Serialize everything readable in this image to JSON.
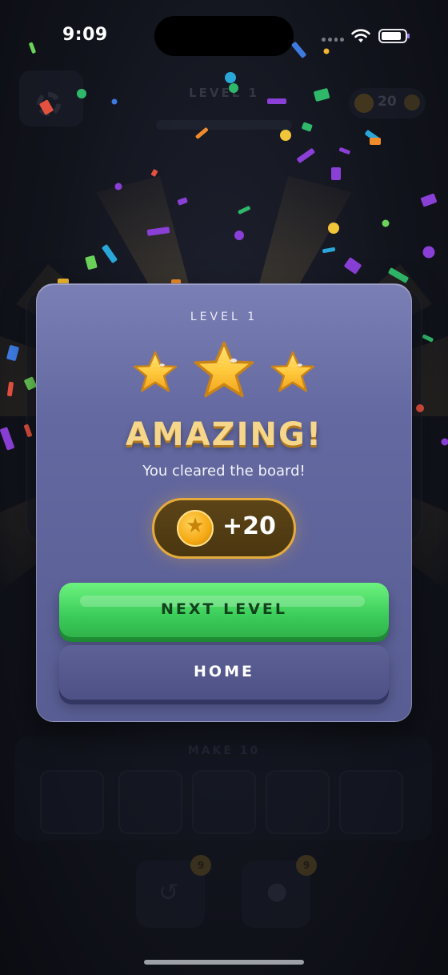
{
  "status_bar": {
    "time": "9:09",
    "icons": [
      "signal-dots-icon",
      "wifi-icon",
      "battery-icon"
    ]
  },
  "background_game": {
    "level_title": "LEVEL 1",
    "coin_count": "20",
    "make_label": "MAKE 10",
    "hint_badges": [
      "9",
      "9"
    ],
    "icons": [
      "gear-icon",
      "coin-icon",
      "plus-icon",
      "undo-icon",
      "lightbulb-icon"
    ]
  },
  "modal": {
    "level_label": "LEVEL 1",
    "stars_earned": 3,
    "stars_total": 3,
    "headline": "AMAZING!",
    "subtitle": "You cleared the board!",
    "reward": {
      "amount": "+20",
      "icon": "coin-star-icon"
    },
    "next_button_label": "NEXT LEVEL",
    "home_button_label": "HOME"
  },
  "colors": {
    "modal_top": "#7a7fb4",
    "modal_bottom": "#585d93",
    "headline": "#f6d68a",
    "star": "#ffc83a",
    "next_button": "#3ccd5a",
    "home_button": "#4d5185",
    "reward_border": "#e4ab3c"
  }
}
